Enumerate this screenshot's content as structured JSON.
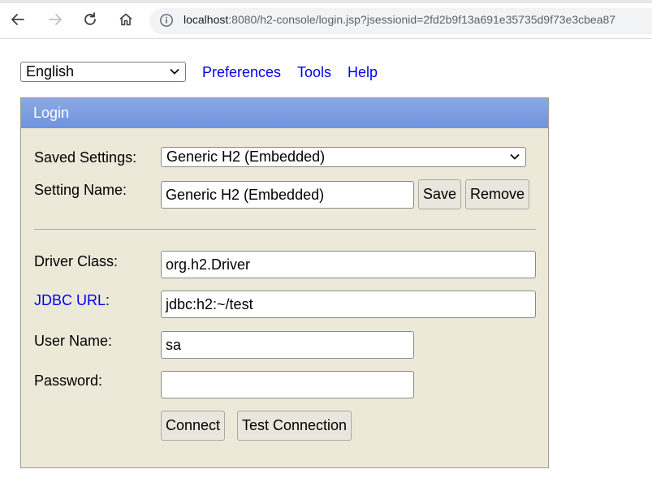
{
  "browser": {
    "url_host": "localhost",
    "url_rest": ":8080/h2-console/login.jsp?jsessionid=2fd2b9f13a691e35735d9f73e3cbea87",
    "icons": [
      "back-arrow-icon",
      "forward-arrow-icon",
      "reload-icon",
      "home-icon",
      "info-icon"
    ]
  },
  "topnav": {
    "language": "English",
    "preferences": "Preferences",
    "tools": "Tools",
    "help": "Help"
  },
  "login": {
    "title": "Login",
    "saved_settings_label": "Saved Settings:",
    "saved_settings_value": "Generic H2 (Embedded)",
    "setting_name_label": "Setting Name:",
    "setting_name_value": "Generic H2 (Embedded)",
    "save_label": "Save",
    "remove_label": "Remove",
    "driver_class_label": "Driver Class:",
    "driver_class_value": "org.h2.Driver",
    "jdbc_url_link": "JDBC URL",
    "jdbc_url_colon": ":",
    "jdbc_url_value": "jdbc:h2:~/test",
    "user_name_label": "User Name:",
    "user_name_value": "sa",
    "password_label": "Password:",
    "password_value": "",
    "connect_label": "Connect",
    "test_connection_label": "Test Connection"
  },
  "colors": {
    "header_blue": "#7a9de2",
    "panel_bg": "#ece9d8",
    "link_blue": "#0000ee"
  }
}
